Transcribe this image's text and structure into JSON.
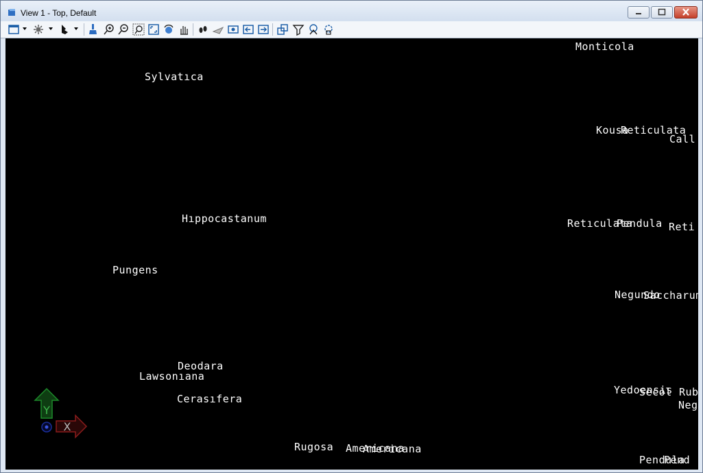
{
  "window": {
    "title": "View 1 - Top, Default"
  },
  "toolbar": {
    "icons": [
      "view-attributes-icon",
      "display-style-icon",
      "lighting-icon",
      "bing-icon",
      "clear-icon",
      "zoom-in-icon",
      "zoom-out-icon",
      "window-area-icon",
      "fit-view-icon",
      "rotate-view-icon",
      "pan-view-icon",
      "walk-icon",
      "fly-icon",
      "view-previous-icon",
      "view-next-icon",
      "copy-view-icon",
      "clip-volume-icon",
      "clip-mask-icon",
      "camera-icon"
    ]
  },
  "viewport": {
    "background": "#000000",
    "labels": [
      {
        "id": "monticola",
        "text": "Monticola"
      },
      {
        "id": "sylvatica",
        "text": "Sylvatıca"
      },
      {
        "id": "kousa",
        "text": "Kousa"
      },
      {
        "id": "reticulata-1",
        "text": "Reticulata"
      },
      {
        "id": "call",
        "text": "Call"
      },
      {
        "id": "hippocastanum",
        "text": "Hıppocastanum"
      },
      {
        "id": "reticulata-2",
        "text": "Retıculata"
      },
      {
        "id": "pendula-1",
        "text": "Pendula"
      },
      {
        "id": "reti",
        "text": "Reti"
      },
      {
        "id": "pungens",
        "text": "Pungens"
      },
      {
        "id": "negundo",
        "text": "Negundo"
      },
      {
        "id": "saccharum",
        "text": "Saccharum"
      },
      {
        "id": "deodara",
        "text": "Deodara"
      },
      {
        "id": "lawsoniana",
        "text": "Lawsonıana"
      },
      {
        "id": "cerasifera",
        "text": "Cerasıfera"
      },
      {
        "id": "yedoensis",
        "text": "Yedoensis"
      },
      {
        "id": "sec-1",
        "text": "Secol"
      },
      {
        "id": "rub",
        "text": "Rub"
      },
      {
        "id": "neg",
        "text": "Neg"
      },
      {
        "id": "rugosa",
        "text": "Rugosa"
      },
      {
        "id": "americana-1",
        "text": "Americana"
      },
      {
        "id": "americana-2",
        "text": "Americana"
      },
      {
        "id": "pendula-2",
        "text": "Pendula"
      },
      {
        "id": "pendula-3",
        "text": "Pend"
      }
    ]
  },
  "triad": {
    "y_label": "Y",
    "x_label": "X",
    "y_color": "#1c8a2a",
    "x_color": "#8a1c1c",
    "z_color": "#1a2f9c"
  }
}
